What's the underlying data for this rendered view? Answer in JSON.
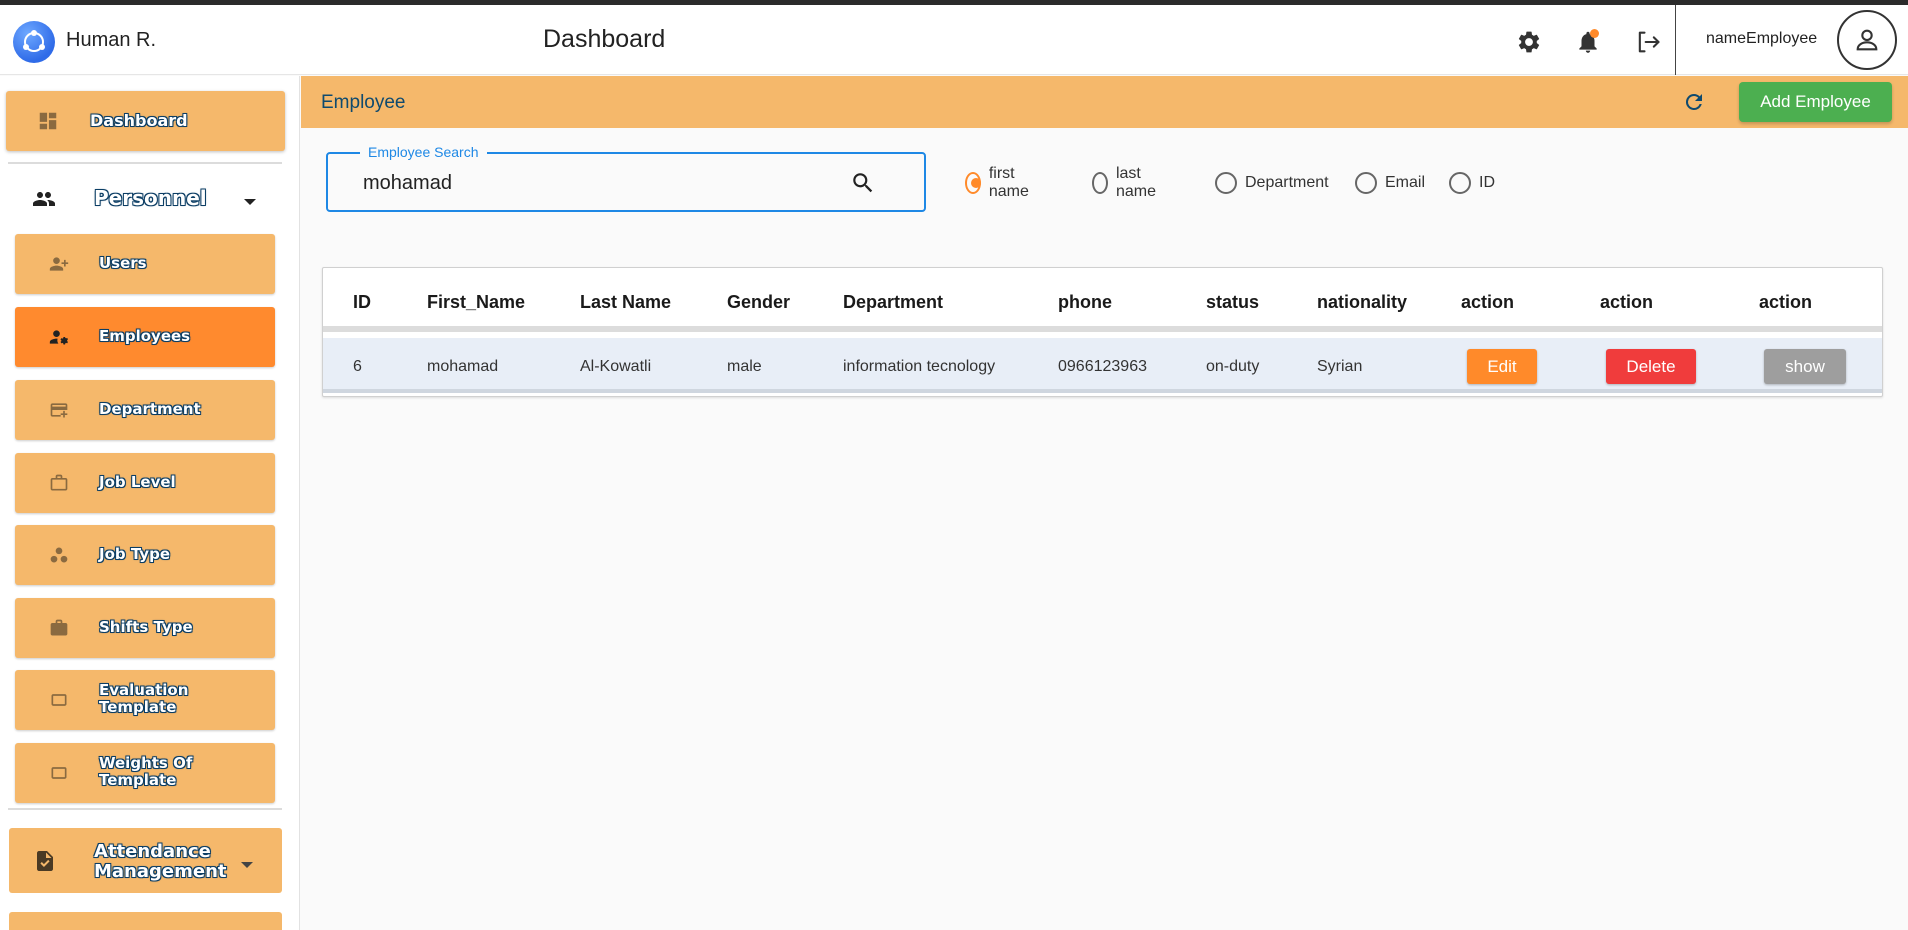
{
  "header": {
    "brand": "Human R.",
    "title": "Dashboard",
    "username": "nameEmployee",
    "icons": [
      "settings-icon",
      "notification-bell-icon",
      "logout-icon",
      "account-icon"
    ]
  },
  "sidebar": {
    "dashboard": "Dashboard",
    "personnel": {
      "label": "Personnel",
      "items": [
        {
          "label": "Users"
        },
        {
          "label": "Employees",
          "active": true
        },
        {
          "label": "Department"
        },
        {
          "label": "Job Level"
        },
        {
          "label": "Job Type"
        },
        {
          "label": "Shifts Type"
        },
        {
          "label": "Evaluation Template"
        },
        {
          "label": "Weights Of Template"
        }
      ]
    },
    "attendance": "Attendance Management"
  },
  "main": {
    "title": "Employee",
    "add_button": "Add Employee",
    "search": {
      "label": "Employee Search",
      "value": "mohamad"
    },
    "filters": [
      {
        "label": "first name",
        "checked": true
      },
      {
        "label": "last name",
        "checked": false
      },
      {
        "label": "Department",
        "checked": false
      },
      {
        "label": "Email",
        "checked": false
      },
      {
        "label": "ID",
        "checked": false
      }
    ],
    "table": {
      "headers": [
        "ID",
        "First_Name",
        "Last Name",
        "Gender",
        "Department",
        "phone",
        "status",
        "nationality",
        "action",
        "action",
        "action"
      ],
      "rows": [
        {
          "id": "6",
          "first_name": "mohamad",
          "last_name": "Al-Kowatli",
          "gender": "male",
          "department": "information tecnology",
          "phone": "0966123963",
          "status": "on-duty",
          "nationality": "Syrian",
          "edit": "Edit",
          "delete": "Delete",
          "show": "show"
        }
      ]
    }
  },
  "colors": {
    "accent": "#f5b86b",
    "active": "#ff8a2e",
    "primary_blue": "#1e88e5",
    "success": "#4caf50",
    "danger": "#f03c3c",
    "neutral": "#9e9e9e"
  }
}
